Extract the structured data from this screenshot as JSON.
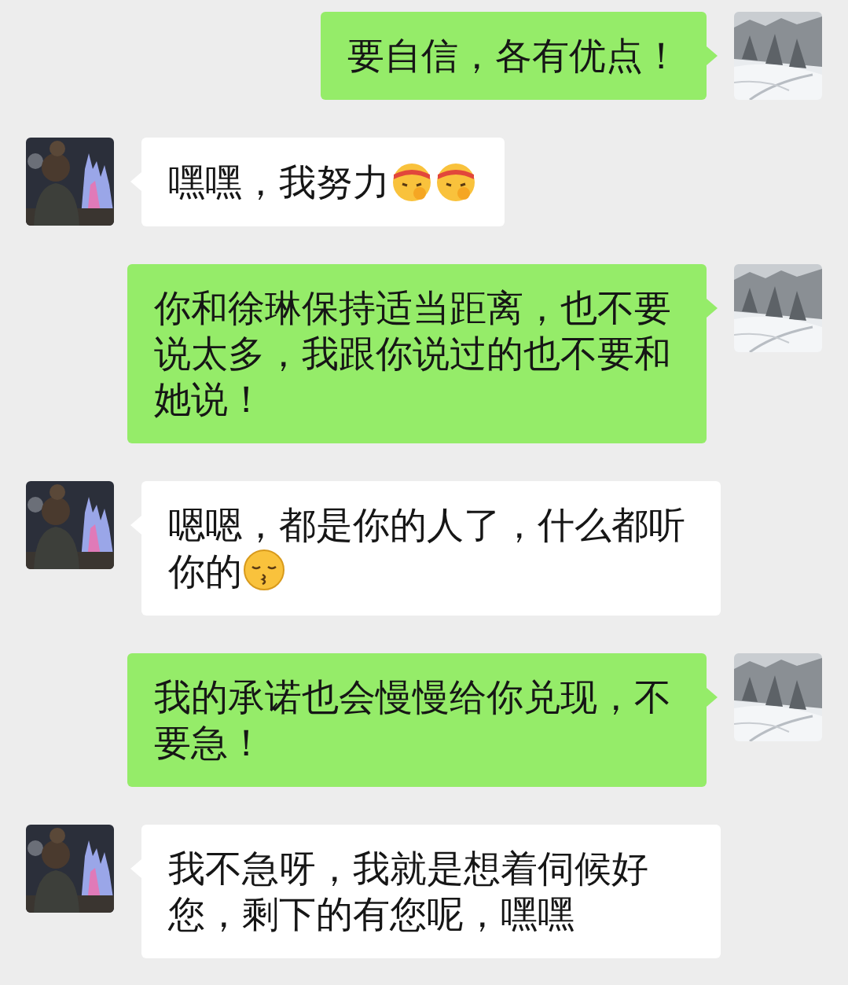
{
  "messages": [
    {
      "kind": "sent",
      "text": "要自信，各有优点！"
    },
    {
      "kind": "received",
      "text": "嘿嘿，我努力",
      "emojis": [
        {
          "kind": "headband"
        },
        {
          "kind": "headband"
        }
      ]
    },
    {
      "kind": "sent",
      "text": "你和徐琳保持适当距离，也不要说太多，我跟你说过的也不要和她说！"
    },
    {
      "kind": "received",
      "text": "嗯嗯，都是你的人了，什么都听你的",
      "emojis": [
        {
          "kind": "kiss"
        }
      ]
    },
    {
      "kind": "sent",
      "text": "我的承诺也会慢慢给你兑现，不要急！"
    },
    {
      "kind": "received",
      "text": "我不急呀，我就是想着伺候好您，剩下的有您呢，嘿嘿"
    }
  ]
}
